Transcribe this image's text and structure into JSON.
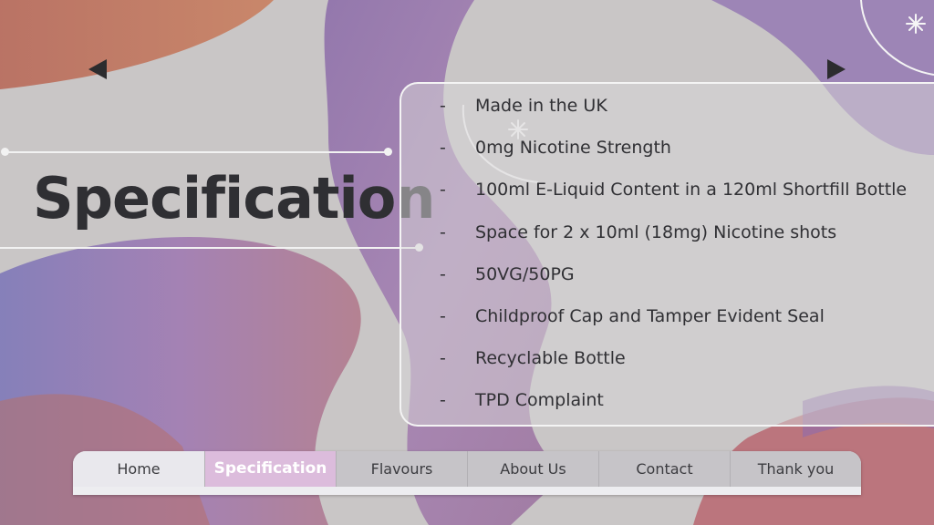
{
  "slide": {
    "title": "Specification",
    "colors": {
      "background": "#c9c6c6",
      "wave_orange": "#c26a5a",
      "wave_purple": "#8f6fa8",
      "text_dark": "#2f2f33",
      "active_tab": "#dcbcdc"
    },
    "icons": {
      "prev": "triangle-left-icon",
      "next": "triangle-right-icon",
      "sparkle": "sparkle-icon"
    }
  },
  "specs": [
    {
      "bullet": "-",
      "text": "Made in the UK"
    },
    {
      "bullet": "-",
      "text": "0mg Nicotine Strength"
    },
    {
      "bullet": "-",
      "text": "100ml E-Liquid Content in a 120ml Shortfill Bottle"
    },
    {
      "bullet": "-",
      "text": "Space for 2 x 10ml (18mg) Nicotine shots"
    },
    {
      "bullet": "-",
      "text": "50VG/50PG"
    },
    {
      "bullet": "-",
      "text": "Childproof Cap and Tamper Evident Seal"
    },
    {
      "bullet": "-",
      "text": "Recyclable Bottle"
    },
    {
      "bullet": "-",
      "text": "TPD Complaint"
    }
  ],
  "nav": {
    "tabs": [
      "Home",
      "Specification",
      "Flavours",
      "About Us",
      "Contact",
      "Thank you"
    ],
    "active": "Specification"
  }
}
